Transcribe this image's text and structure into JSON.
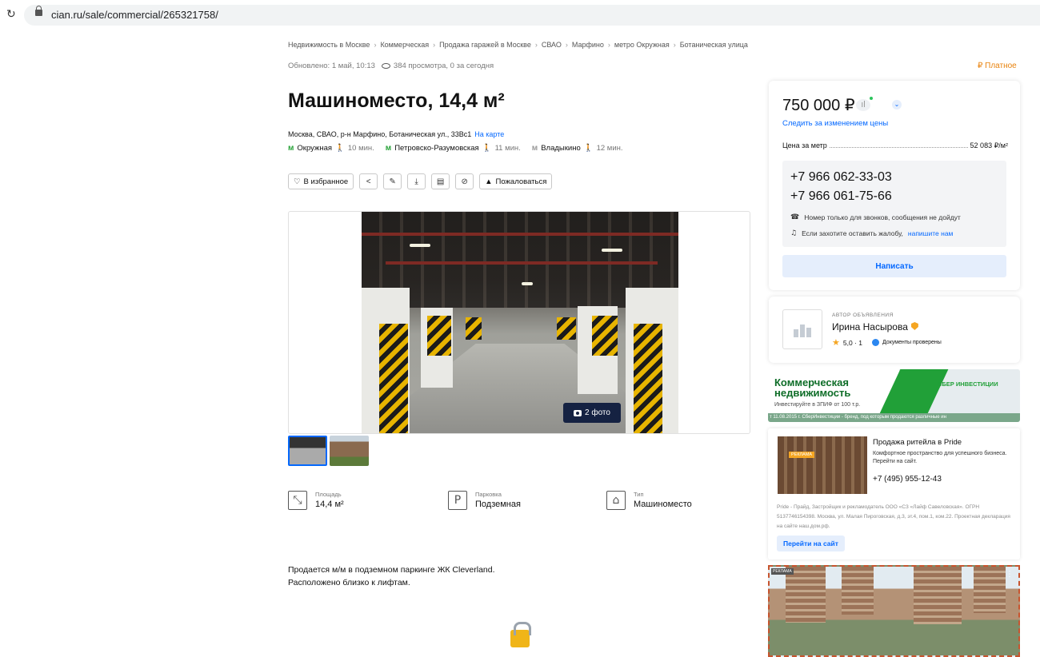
{
  "browser": {
    "url": "cian.ru/sale/commercial/265321758/"
  },
  "breadcrumbs": [
    "Недвижимость в Москве",
    "Коммерческая",
    "Продажа гаражей в Москве",
    "СВАО",
    "Марфино",
    "метро Окружная",
    "Ботаническая улица"
  ],
  "meta": {
    "updated": "Обновлено: 1 май, 10:13",
    "views": "384 просмотра, 0 за сегодня",
    "paid": "₽ Платное"
  },
  "title": "Машиноместо, 14,4 м²",
  "address": {
    "text": "Москва, СВАО, р-н Марфино, Ботаническая ул., 33Вс1",
    "map_link": "На карте"
  },
  "metro": [
    {
      "name": "Окружная",
      "walk": "10 мин."
    },
    {
      "name": "Петровско-Разумовская",
      "walk": "11 мин."
    },
    {
      "name": "Владыкино",
      "walk": "12 мин."
    }
  ],
  "actions": {
    "favorite": "В избранное",
    "report": "Пожаловаться"
  },
  "gallery": {
    "count": "2 фото"
  },
  "features": [
    {
      "label": "Площадь",
      "value": "14,4 м²",
      "icon": "area-icon"
    },
    {
      "label": "Парковка",
      "value": "Подземная",
      "icon": "parking-icon"
    },
    {
      "label": "Тип",
      "value": "Машиноместо",
      "icon": "garage-icon"
    }
  ],
  "description": [
    "Продается м/м в подземном паркинге ЖК Cleverland.",
    "Расположено близко к лифтам."
  ],
  "price_card": {
    "price": "750 000 ₽",
    "watch": "Следить за изменением цены",
    "per_meter_label": "Цена за метр",
    "per_meter_value": "52 083 ₽/м²",
    "phones": [
      "+7 966 062-33-03",
      "+7 966 061-75-66"
    ],
    "note_calls": "Номер только для звонков, сообщения не дойдут",
    "note_complaint": "Если захотите оставить жалобу,",
    "note_link": "напишите нам",
    "write": "Написать"
  },
  "author": {
    "role": "АВТОР ОБЪЯВЛЕНИЯ",
    "name": "Ирина Насырова",
    "rating": "5,0 · 1",
    "docs": "Документы проверены"
  },
  "banner_sber": {
    "title1": "Коммерческая",
    "title2": "недвижимость",
    "sub": "Инвестируйте в ЗПИФ от 100 т.р.",
    "brand": "СБЕР ИНВЕСТИЦИИ",
    "legal": "т 11.08.2015 г. СберИнвестиции - бренд, под которым продаются различные ин"
  },
  "ad": {
    "tag": "РЕКЛАМА",
    "title": "Продажа ритейла в Pride",
    "text": "Комфортное пространство для успешного бизнеса. Перейти на сайт.",
    "phone": "+7 (495) 955-12-43",
    "legal": "Pride - Прайд, Застройщик и рекламодатель ООО «СЗ «Лайф Савеловская». ОГРН 5137746154398. Москва, ул. Малая Пироговская, д.3, эт.4, пом.1, ком.22. Проектная декларация на сайте наш.дом.рф.",
    "button": "Перейти на сайт"
  },
  "banner_bottom": {
    "tag": "РЕКЛАМА"
  }
}
